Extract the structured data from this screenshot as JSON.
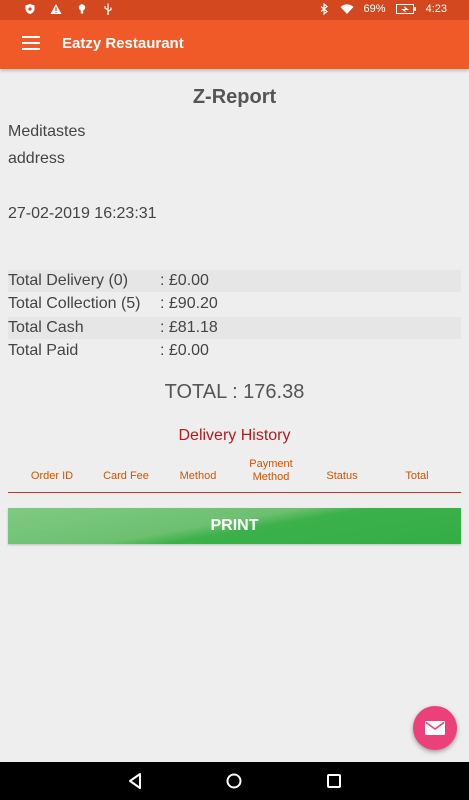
{
  "status_bar": {
    "icons": [
      "shield-icon",
      "warning-icon",
      "lightbulb-icon",
      "usb-icon",
      "bluetooth-icon",
      "wifi-icon",
      "battery-icon"
    ],
    "battery": "69%",
    "time": "4:23"
  },
  "app_bar": {
    "title": "Eatzy Restaurant",
    "menu_icon": "menu-icon"
  },
  "report": {
    "title": "Z-Report",
    "restaurant_name": "Meditastes",
    "address": "address",
    "datetime": "27-02-2019 16:23:31",
    "summary": [
      {
        "label": "Total Delivery (0)",
        "value": ": £0.00"
      },
      {
        "label": "Total Collection (5)",
        "value": ": £90.20"
      },
      {
        "label": "Total Cash",
        "value": ": £81.18"
      },
      {
        "label": "Total Paid",
        "value": ": £0.00"
      }
    ],
    "total": "TOTAL : 176.38"
  },
  "delivery_history": {
    "title": "Delivery History",
    "columns": [
      "Order ID",
      "Card Fee",
      "Method",
      "Payment Method",
      "Status",
      "Total"
    ]
  },
  "actions": {
    "print_label": "PRINT",
    "fab_icon": "email-icon"
  },
  "colors": {
    "status_bar": "#d4481f",
    "app_bar": "#f05a28",
    "history_title": "#b71c1c",
    "table_header": "#d35400",
    "print_button": "#4caf50",
    "fab": "#ec407a"
  }
}
